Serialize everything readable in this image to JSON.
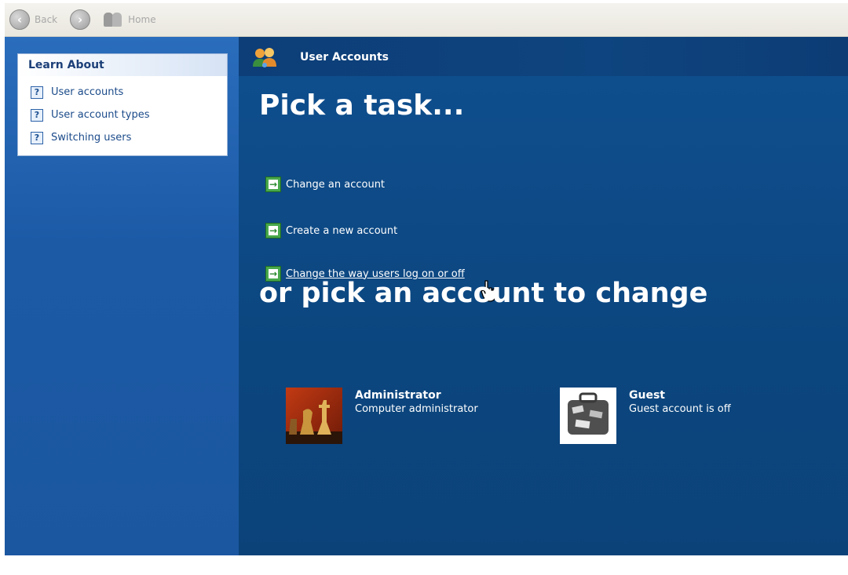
{
  "toolbar": {
    "back_label": "Back",
    "home_label": "Home"
  },
  "header": {
    "title": "User Accounts"
  },
  "learn_about": {
    "title": "Learn About",
    "items": [
      {
        "label": "User accounts"
      },
      {
        "label": "User account types"
      },
      {
        "label": "Switching users"
      }
    ]
  },
  "tasks": {
    "heading": "Pick a task...",
    "items": [
      {
        "label": "Change an account"
      },
      {
        "label": "Create a new account"
      },
      {
        "label": "Change the way users log on or off"
      }
    ]
  },
  "accounts": {
    "heading": "or pick an account to change",
    "items": [
      {
        "name": "Administrator",
        "description": "Computer administrator"
      },
      {
        "name": "Guest",
        "description": "Guest account is off"
      }
    ]
  },
  "icons": {
    "back": "back-arrow-icon",
    "forward": "forward-arrow-icon",
    "home": "home-users-icon",
    "help": "help-question-icon",
    "task_arrow": "green-arrow-icon",
    "cursor": "hand-pointer-icon"
  },
  "colors": {
    "right_pane": "#0f4a87",
    "left_pane": "#1c5aa6",
    "task_arrow": "#49a84c",
    "learn_title": "#1c3f78"
  }
}
